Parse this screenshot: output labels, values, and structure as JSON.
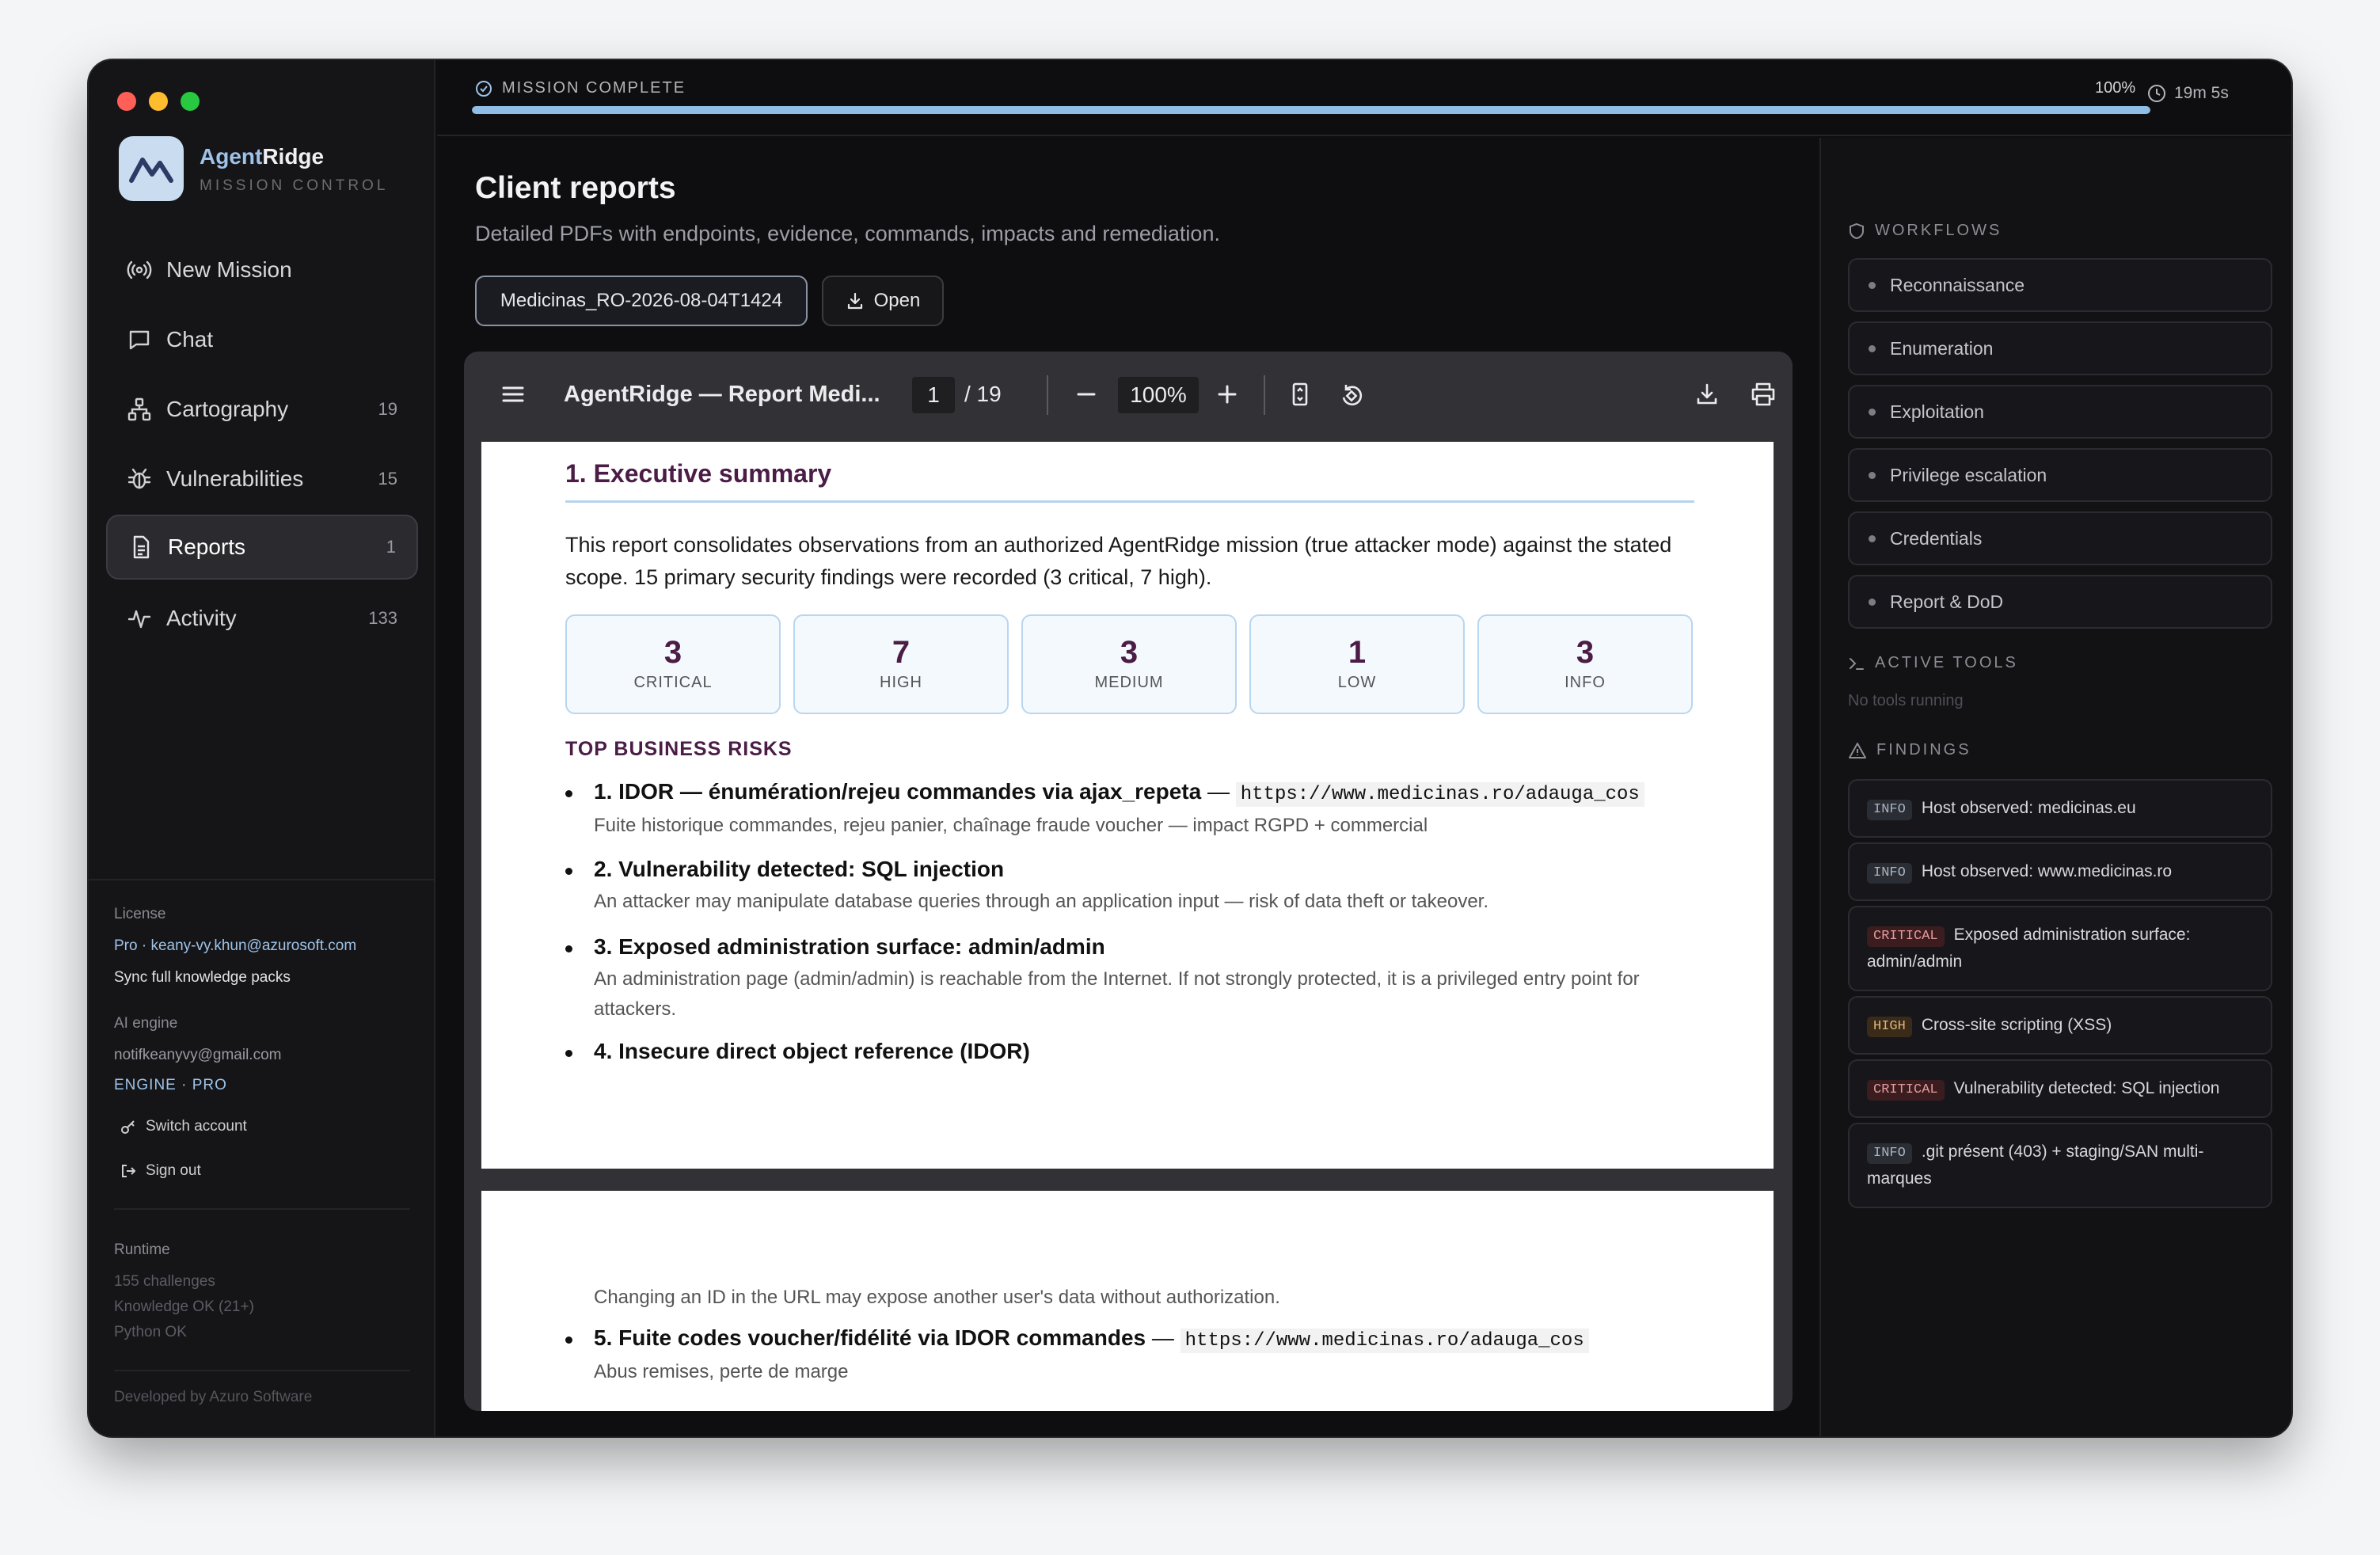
{
  "progress": {
    "status": "MISSION COMPLETE",
    "percent_label": "100%",
    "percent": 100,
    "elapsed": "19m 5s"
  },
  "brand": {
    "name_a": "Agent",
    "name_b": "Ridge",
    "subtitle": "MISSION CONTROL"
  },
  "nav": [
    {
      "label": "New Mission",
      "count": "",
      "icon": "broadcast-icon"
    },
    {
      "label": "Chat",
      "count": "",
      "icon": "chat-icon"
    },
    {
      "label": "Cartography",
      "count": "19",
      "icon": "network-icon"
    },
    {
      "label": "Vulnerabilities",
      "count": "15",
      "icon": "bug-icon"
    },
    {
      "label": "Reports",
      "count": "1",
      "icon": "document-icon"
    },
    {
      "label": "Activity",
      "count": "133",
      "icon": "activity-icon"
    }
  ],
  "sidebar_footer": {
    "license_label": "License",
    "license_value": "Pro · keany-vy.khun@azurosoft.com",
    "sync": "Sync full knowledge packs",
    "ai_label": "AI engine",
    "ai_email": "notifkeanyvy@gmail.com",
    "ai_engine": "ENGINE · PRO",
    "switch": "Switch account",
    "signout": "Sign out",
    "runtime_label": "Runtime",
    "runtime_lines": [
      "155 challenges",
      "Knowledge OK (21+)",
      "Python OK"
    ],
    "developed": "Developed by Azuro Software"
  },
  "main": {
    "title": "Client reports",
    "subtitle": "Detailed PDFs with endpoints, evidence, commands, impacts and remediation.",
    "file_button": "Medicinas_RO-2026-08-04T1424",
    "open_button": "Open"
  },
  "pdf": {
    "doc_title": "AgentRidge — Report Medi...",
    "page": "1",
    "page_total": "/ 19",
    "zoom": "100%",
    "section": "1. Executive summary",
    "intro": "This report consolidates observations from an authorized AgentRidge mission (true attacker mode) against the stated scope. 15 primary security findings were recorded (3 critical, 7 high).",
    "cards": [
      {
        "n": "3",
        "l": "CRITICAL"
      },
      {
        "n": "7",
        "l": "HIGH"
      },
      {
        "n": "3",
        "l": "MEDIUM"
      },
      {
        "n": "1",
        "l": "LOW"
      },
      {
        "n": "3",
        "l": "INFO"
      }
    ],
    "risks_title": "TOP BUSINESS RISKS",
    "risks": [
      {
        "title": "1. IDOR — énumération/rejeu commandes via ajax_repeta",
        "sep": "—",
        "url": "https://www.medicinas.ro/adauga_cos",
        "desc": "Fuite historique commandes, rejeu panier, chaînage fraude voucher — impact RGPD + commercial"
      },
      {
        "title": "2. Vulnerability detected: SQL injection",
        "desc": "An attacker may manipulate database queries through an application input — risk of data theft or takeover."
      },
      {
        "title": "3. Exposed administration surface: admin/admin",
        "desc": "An administration page (admin/admin) is reachable from the Internet. If not strongly protected, it is a privileged entry point for attackers."
      },
      {
        "title": "4. Insecure direct object reference (IDOR)"
      }
    ],
    "page2_desc": "Changing an ID in the URL may expose another user's data without authorization.",
    "risk5": {
      "title": "5. Fuite codes voucher/fidélité via IDOR commandes",
      "sep": "—",
      "url": "https://www.medicinas.ro/adauga_cos",
      "desc": "Abus remises, perte de marge"
    }
  },
  "right": {
    "workflows_title": "WORKFLOWS",
    "workflows": [
      "Reconnaissance",
      "Enumeration",
      "Exploitation",
      "Privilege escalation",
      "Credentials",
      "Report & DoD"
    ],
    "tools_title": "ACTIVE TOOLS",
    "tools_empty": "No tools running",
    "findings_title": "FINDINGS",
    "findings": [
      {
        "sev": "INFO",
        "text": "Host observed: medicinas.eu"
      },
      {
        "sev": "INFO",
        "text": "Host observed: www.medicinas.ro"
      },
      {
        "sev": "CRITICAL",
        "text": "Exposed administration surface: admin/admin"
      },
      {
        "sev": "HIGH",
        "text": "Cross-site scripting (XSS)"
      },
      {
        "sev": "CRITICAL",
        "text": "Vulnerability detected: SQL injection"
      },
      {
        "sev": "INFO",
        "text": ".git présent (403) + staging/SAN multi-marques"
      }
    ]
  },
  "colors": {
    "accent": "#8fbde6",
    "critical": "#e59a9c",
    "high": "#e0b57b",
    "heading": "#4b1c45"
  }
}
